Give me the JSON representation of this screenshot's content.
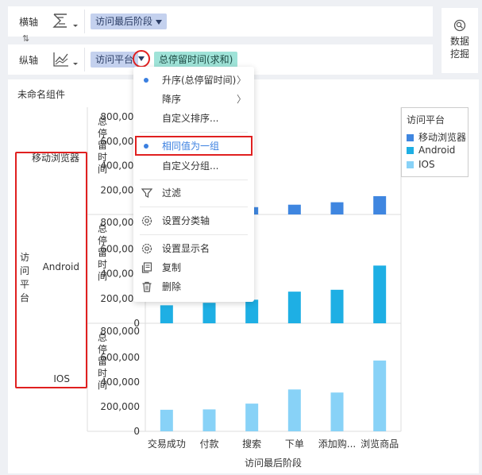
{
  "axes": {
    "x_label": "横轴",
    "y_label": "纵轴",
    "x_field": "访问最后阶段",
    "y_field": "访问平台",
    "y_measure": "总停留时间(求和)"
  },
  "side_button": {
    "line1": "数据",
    "line2": "挖掘"
  },
  "component_title": "未命名组件",
  "menu": {
    "items": [
      {
        "label": "升序(总停留时间)",
        "dot": true,
        "arrow": true
      },
      {
        "label": "降序",
        "arrow": true
      },
      {
        "label": "自定义排序..."
      },
      {
        "label": "相同值为一组",
        "dot": true,
        "active": true
      },
      {
        "label": "自定义分组..."
      },
      {
        "label": "过滤",
        "icon": "filter-icon"
      },
      {
        "label": "设置分类轴",
        "icon": "gear-icon"
      },
      {
        "label": "设置显示名",
        "icon": "gear-icon"
      },
      {
        "label": "复制",
        "icon": "copy-icon"
      },
      {
        "label": "删除",
        "icon": "trash-icon"
      }
    ],
    "arrow_char": "〉"
  },
  "legend": {
    "title": "访问平台",
    "items": [
      "移动浏览器",
      "Android",
      "IOS"
    ]
  },
  "colors": {
    "bar_mobile": "#3f86e0",
    "bar_android": "#1eafe4",
    "bar_ios": "#88d2f7",
    "highlight": "#e02020"
  },
  "chart_data": {
    "type": "bar",
    "categories": [
      "交易成功",
      "付款",
      "搜索",
      "下单",
      "添加购...",
      "浏览商品"
    ],
    "xlabel": "访问最后阶段",
    "row_label": "访问平台",
    "ylabel": "总停留时间",
    "ylim": [
      0,
      800000
    ],
    "yticks": [
      "800,000",
      "600,000",
      "400,000",
      "200,000",
      "0"
    ],
    "panels": [
      {
        "name": "移动浏览器",
        "values": [
          45000,
          55000,
          60000,
          80000,
          100000,
          150000
        ]
      },
      {
        "name": "Android",
        "values": [
          145000,
          165000,
          190000,
          255000,
          270000,
          465000
        ]
      },
      {
        "name": "IOS",
        "values": [
          175000,
          178000,
          225000,
          340000,
          315000,
          575000
        ]
      }
    ]
  }
}
